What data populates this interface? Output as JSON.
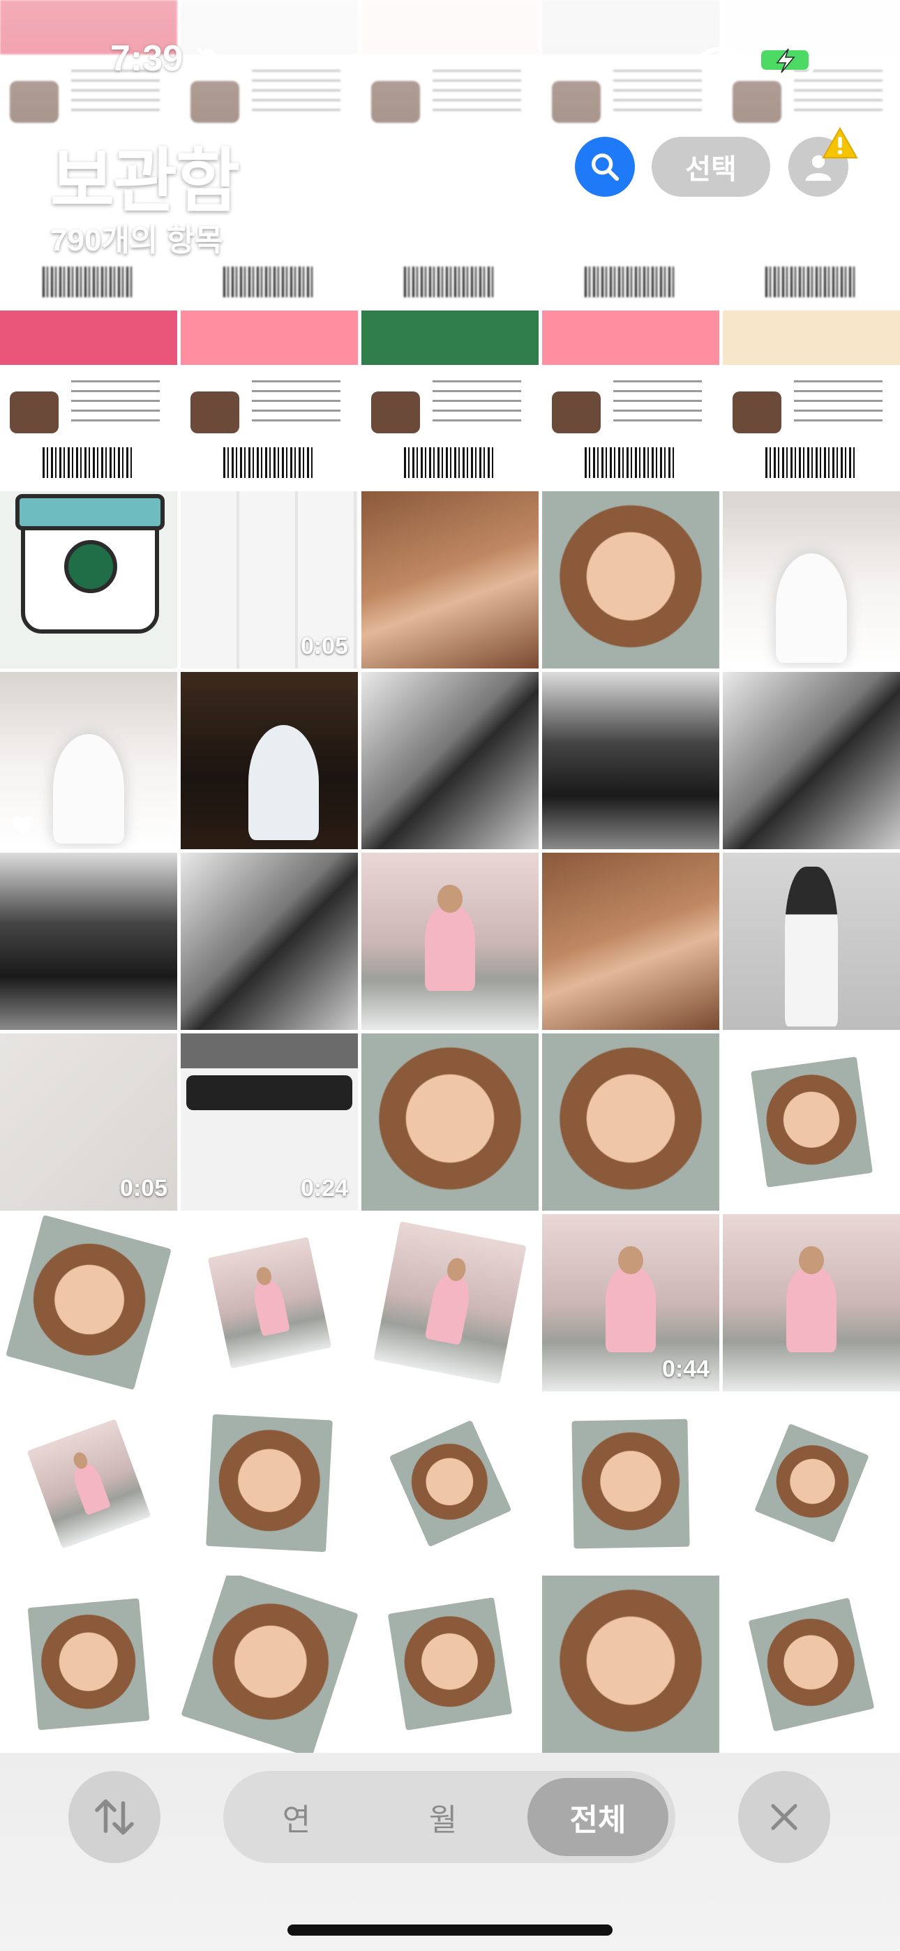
{
  "status_bar": {
    "time": "7:39",
    "icons": [
      "bell-slash-icon",
      "wifi-icon",
      "battery-charging-icon"
    ]
  },
  "header": {
    "title": "보관함",
    "item_count": "790개의 항목",
    "select_label": "선택",
    "icons": [
      "search-icon",
      "account-icon",
      "warning-icon"
    ]
  },
  "grid": {
    "columns": 5,
    "tiles": [
      {
        "kind": "coupon-top",
        "duration": ""
      },
      {
        "kind": "coupon-top",
        "duration": ""
      },
      {
        "kind": "coupon-top",
        "duration": ""
      },
      {
        "kind": "coupon-top",
        "duration": ""
      },
      {
        "kind": "coupon-top",
        "duration": ""
      },
      {
        "kind": "coupon",
        "duration": ""
      },
      {
        "kind": "coupon",
        "duration": ""
      },
      {
        "kind": "coupon",
        "duration": ""
      },
      {
        "kind": "coupon",
        "duration": ""
      },
      {
        "kind": "coupon",
        "duration": ""
      },
      {
        "kind": "cup",
        "duration": ""
      },
      {
        "kind": "collage",
        "duration": "0:05"
      },
      {
        "kind": "face",
        "duration": ""
      },
      {
        "kind": "face2",
        "duration": ""
      },
      {
        "kind": "bride",
        "duration": ""
      },
      {
        "kind": "bride",
        "duration": "",
        "favorite": true
      },
      {
        "kind": "night",
        "duration": ""
      },
      {
        "kind": "bw",
        "duration": ""
      },
      {
        "kind": "bw2",
        "duration": ""
      },
      {
        "kind": "bw",
        "duration": ""
      },
      {
        "kind": "bw2",
        "duration": ""
      },
      {
        "kind": "bw",
        "duration": ""
      },
      {
        "kind": "blossom",
        "duration": ""
      },
      {
        "kind": "face",
        "duration": ""
      },
      {
        "kind": "grey",
        "duration": ""
      },
      {
        "kind": "wall",
        "duration": "0:05"
      },
      {
        "kind": "app",
        "duration": "0:24"
      },
      {
        "kind": "face2",
        "duration": ""
      },
      {
        "kind": "face2",
        "duration": ""
      },
      {
        "kind": "white-face",
        "duration": ""
      },
      {
        "kind": "white-face",
        "duration": ""
      },
      {
        "kind": "white-blossom",
        "duration": ""
      },
      {
        "kind": "white-blossom",
        "duration": ""
      },
      {
        "kind": "blossom",
        "duration": "0:44"
      },
      {
        "kind": "blossom",
        "duration": ""
      },
      {
        "kind": "white-blossom",
        "duration": ""
      },
      {
        "kind": "white-face",
        "duration": ""
      },
      {
        "kind": "white-face",
        "duration": ""
      },
      {
        "kind": "white-face",
        "duration": ""
      },
      {
        "kind": "white-face",
        "duration": ""
      },
      {
        "kind": "white-face",
        "duration": ""
      },
      {
        "kind": "white-face",
        "duration": ""
      },
      {
        "kind": "white-face",
        "duration": ""
      },
      {
        "kind": "face2",
        "duration": ""
      },
      {
        "kind": "white-face",
        "duration": ""
      }
    ]
  },
  "bottom_bar": {
    "segments": [
      "연",
      "월",
      "전체"
    ],
    "active_segment": "전체",
    "icons": [
      "sort-arrows-icon",
      "close-icon"
    ]
  },
  "colors": {
    "accent_blue": "#1f7af7",
    "warning_yellow": "#f5c400",
    "battery_green": "#4cd964"
  }
}
